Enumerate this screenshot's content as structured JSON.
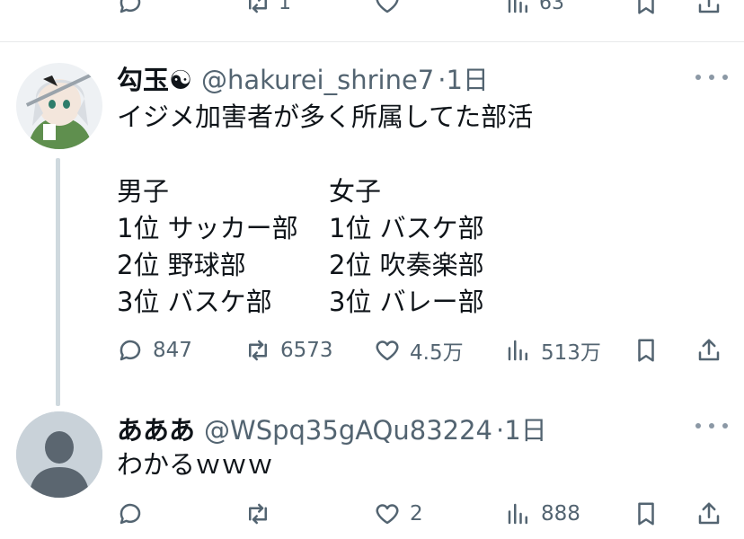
{
  "previous_tweet": {
    "retweets": "1",
    "views": "63"
  },
  "tweets": [
    {
      "name": "勾玉☯",
      "handle": "@hakurei_shrine7",
      "time": "·1日",
      "text": "イジメ加害者が多く所属してた部活",
      "ranking": {
        "left_header": "男子",
        "right_header": "女子",
        "left": [
          "1位 サッカー部",
          "2位 野球部",
          "3位 バスケ部"
        ],
        "right": [
          "1位 バスケ部",
          "2位 吹奏楽部",
          "3位 バレー部"
        ]
      },
      "replies": "847",
      "retweets": "6573",
      "likes": "4.5万",
      "views": "513万"
    },
    {
      "name": "あああ",
      "handle": "@WSpq35gAQu83224",
      "time": "·1日",
      "text": "わかるｗｗｗ",
      "replies": "",
      "retweets": "",
      "likes": "2",
      "views": "888"
    }
  ],
  "colors": {
    "text": "#0f1419",
    "muted": "#536471",
    "divider": "#e7e9ea",
    "thread_line": "#cfd9de"
  }
}
